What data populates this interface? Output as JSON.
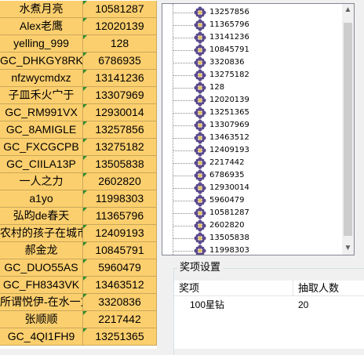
{
  "sheet": {
    "rows": [
      {
        "name": "水煮月亮",
        "id": "10581287"
      },
      {
        "name": "Alex老鹰",
        "id": "12020139"
      },
      {
        "name": "yelling_999",
        "id": "128"
      },
      {
        "name": "GC_DHKGY8RK",
        "id": "6786935"
      },
      {
        "name": "nfzwycmdxz",
        "id": "13141236"
      },
      {
        "name": "子皿禾火宀于",
        "id": "13307969"
      },
      {
        "name": "GC_RM991VX",
        "id": "12930014"
      },
      {
        "name": "GC_8AMIGLE",
        "id": "13257856"
      },
      {
        "name": "GC_FXCGCPB",
        "id": "13275182"
      },
      {
        "name": "GC_CIILA13P",
        "id": "13505838"
      },
      {
        "name": "一人之力",
        "id": "2602820"
      },
      {
        "name": "a1yo",
        "id": "11998303"
      },
      {
        "name": "弘昀de春天",
        "id": "11365796"
      },
      {
        "name": "农村的孩子在城市",
        "id": "12409193"
      },
      {
        "name": "郝金龙",
        "id": "10845791"
      },
      {
        "name": "GC_DUO55AS",
        "id": "5960479"
      },
      {
        "name": "GC_FH8343VK",
        "id": "13463512"
      },
      {
        "name": "所谓悦伊-在水一方",
        "id": "3320836"
      },
      {
        "name": "张顺顺",
        "id": "2217442"
      },
      {
        "name": "GC_4QI1FH9",
        "id": "13251365"
      }
    ]
  },
  "tree": {
    "icon": "flower-icon",
    "items": [
      "13257856",
      "11365796",
      "13141236",
      "10845791",
      "3320836",
      "13275182",
      "128",
      "12020139",
      "13251365",
      "13307969",
      "13463512",
      "12409193",
      "2217442",
      "6786935",
      "12930014",
      "5960479",
      "10581287",
      "2602820",
      "13505838",
      "11998303"
    ]
  },
  "scrollbar": {
    "up_glyph": "▲",
    "down_glyph": "▼"
  },
  "prize_group": {
    "title": "奖项设置",
    "columns": [
      "奖项",
      "抽取人数"
    ],
    "rows": [
      {
        "prize": "100星钻",
        "count": "20"
      }
    ]
  },
  "colors": {
    "cell_bg": "#fccf6e",
    "cell_border": "#c8a85a",
    "icon": "#5b4a8c"
  }
}
